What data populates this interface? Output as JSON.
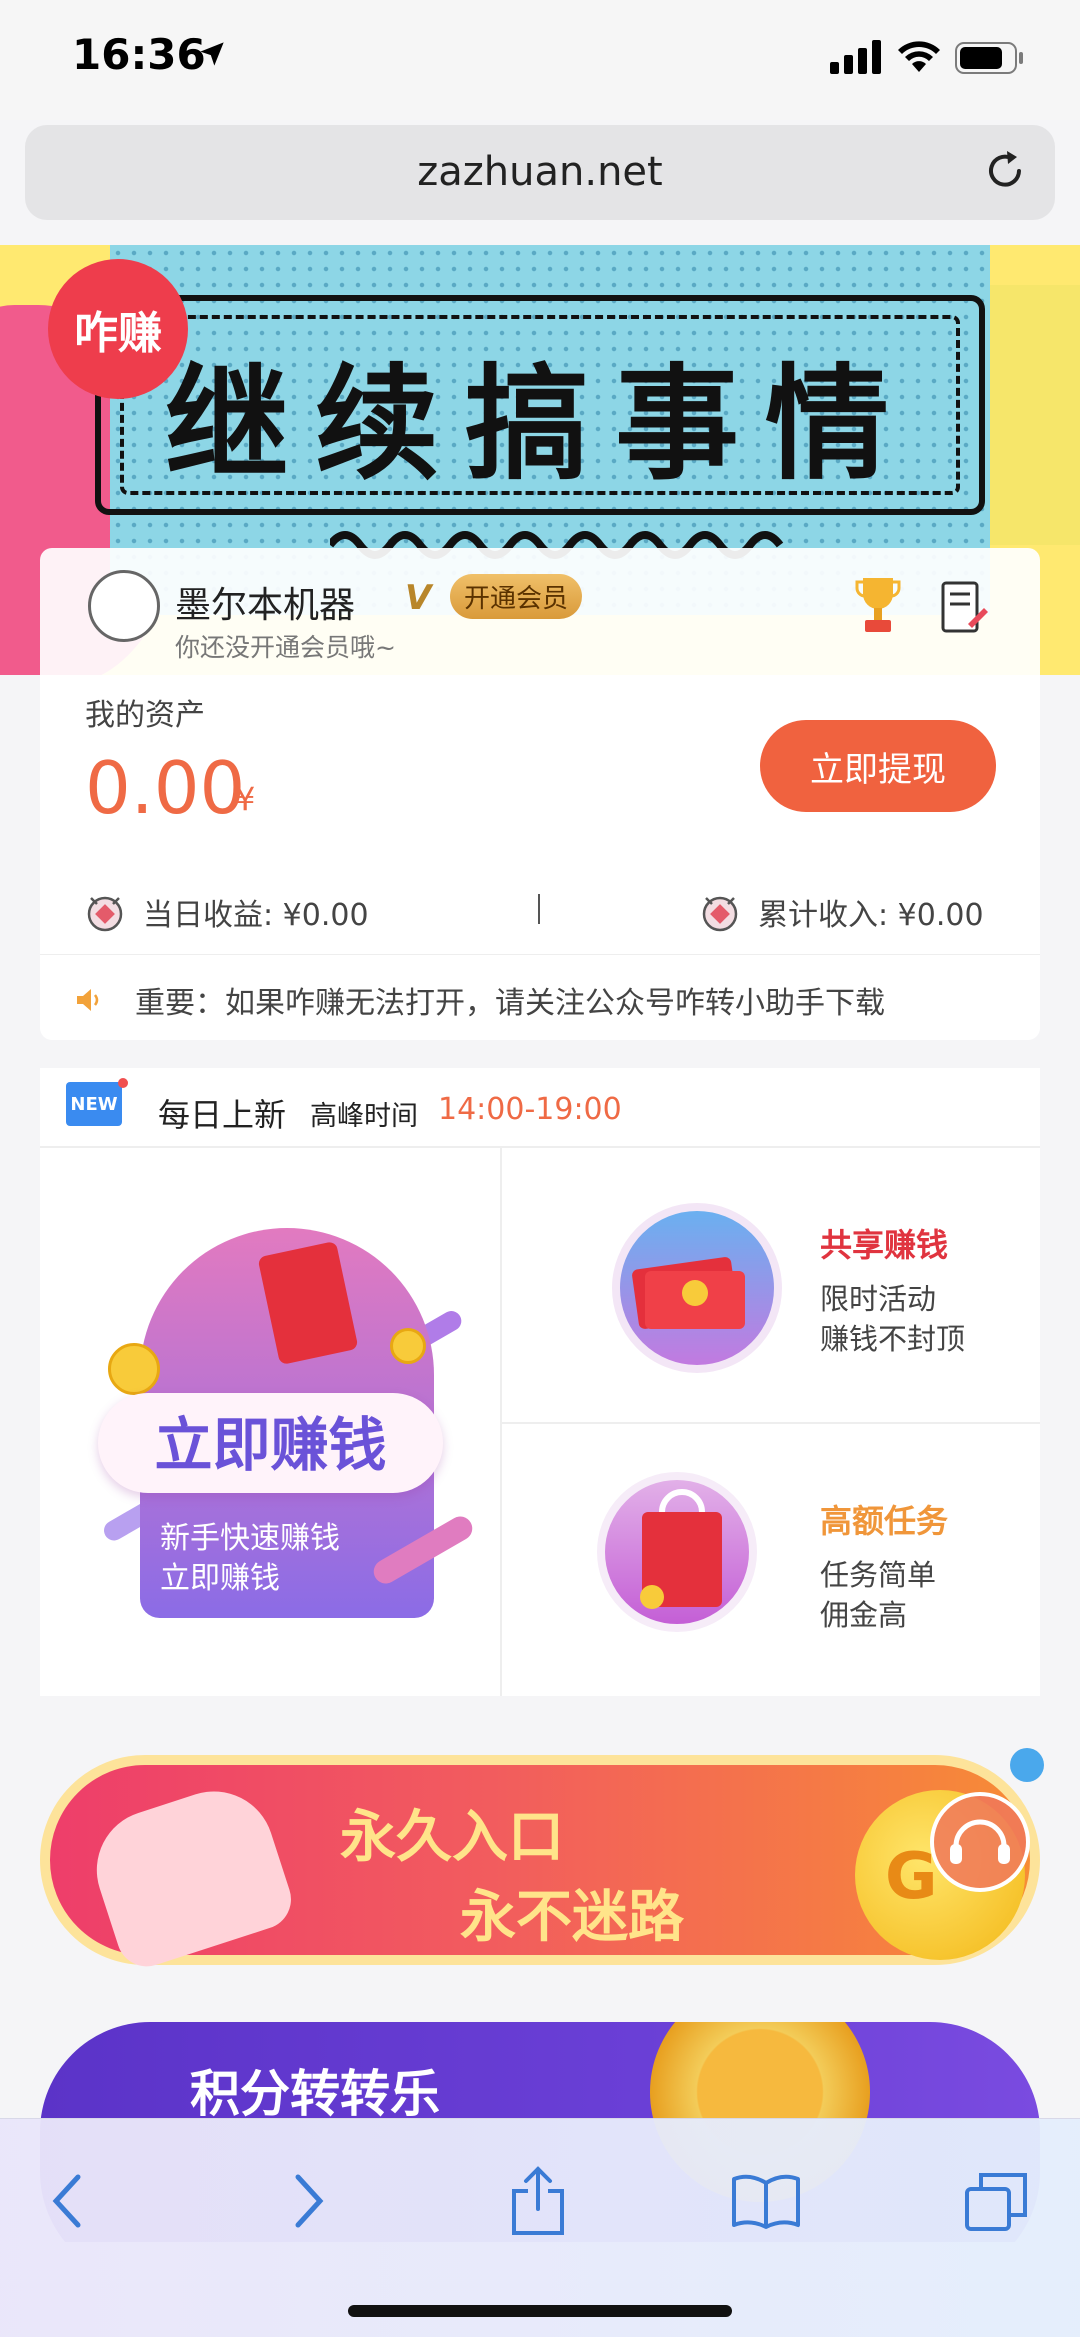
{
  "status_bar": {
    "time": "16:36"
  },
  "browser": {
    "url": "zazhuan.net"
  },
  "hero": {
    "badge": "咋赚",
    "title": "继续搞事情"
  },
  "profile": {
    "name": "墨尔本机器",
    "v_mark": "V",
    "vip_button": "开通会员",
    "subtitle": "你还没开通会员哦~"
  },
  "assets": {
    "label": "我的资产",
    "amount": "0.00",
    "currency": "¥",
    "withdraw_button": "立即提现",
    "daily_income": "当日收益: ¥0.00",
    "total_income": "累计收入: ¥0.00",
    "notice": "重要：如果咋赚无法打开，请关注公众号咋转小助手下载"
  },
  "daily": {
    "badge": "NEW",
    "title": "每日上新",
    "peak_label": "高峰时间",
    "peak_time": "14:00-19:00",
    "earn_now": {
      "title": "立即赚钱",
      "line1": "新手快速赚钱",
      "line2": "立即赚钱"
    },
    "share": {
      "title": "共享赚钱",
      "line1": "限时活动",
      "line2": "赚钱不封顶",
      "color": "#e0343f"
    },
    "high_task": {
      "title": "高额任务",
      "line1": "任务简单",
      "line2": "佣金高",
      "color": "#f0963a"
    }
  },
  "banners": {
    "forever_line1": "永久入口",
    "forever_line2": "永不迷路",
    "coin_letter": "G",
    "points": "积分转转乐"
  },
  "colors": {
    "accent": "#f0623f",
    "amount": "#ef6a45",
    "purple": "#6a52d8"
  }
}
